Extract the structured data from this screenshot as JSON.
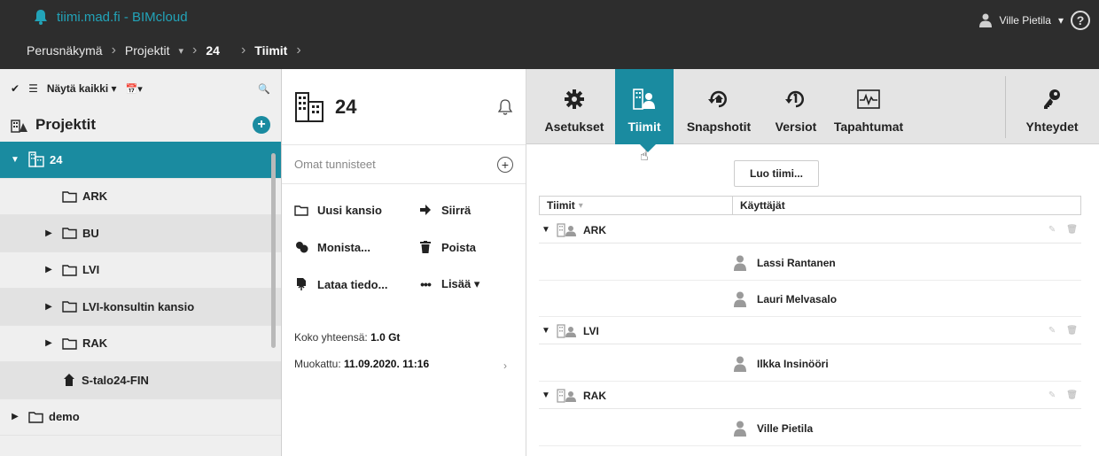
{
  "app": {
    "title": "tiimi.mad.fi - BIMcloud",
    "user": "Ville Pietila",
    "user_caret": "▾",
    "help": "?"
  },
  "breadcrumb": [
    {
      "label": "Perusnäkymä"
    },
    {
      "label": "Projektit",
      "dropdown": "▾"
    },
    {
      "label": "24"
    },
    {
      "label": "Tiimit"
    }
  ],
  "left": {
    "toolbar": {
      "check": "✔",
      "menu": "☰",
      "filter": "Näytä kaikki ▾",
      "calendar": "📅▾",
      "search": "🔍"
    },
    "title": "Projektit",
    "add": "+",
    "items": [
      {
        "label": "24",
        "caret": "▼",
        "kind": "building",
        "selected": true,
        "indent": 0
      },
      {
        "label": "ARK",
        "caret": "",
        "kind": "folder",
        "indent": 1
      },
      {
        "label": "BU",
        "caret": "▶",
        "kind": "folder",
        "indent": 1
      },
      {
        "label": "LVI",
        "caret": "▶",
        "kind": "folder",
        "indent": 1
      },
      {
        "label": "LVI-konsultin kansio",
        "caret": "▶",
        "kind": "folder",
        "indent": 1
      },
      {
        "label": "RAK",
        "caret": "▶",
        "kind": "folder",
        "indent": 1
      },
      {
        "label": "S-talo24-FIN",
        "caret": "",
        "kind": "model",
        "indent": 1
      },
      {
        "label": "demo",
        "caret": "▶",
        "kind": "folder",
        "indent": 0
      }
    ]
  },
  "mid": {
    "number": "24",
    "tags_placeholder": "Omat tunnisteet",
    "tags_add": "+",
    "actions": [
      {
        "label": "Uusi kansio",
        "icon": "folder-icon"
      },
      {
        "label": "Siirrä",
        "icon": "move-arrow-icon"
      },
      {
        "label": "Monista...",
        "icon": "duplicate-icon"
      },
      {
        "label": "Poista",
        "icon": "trash-icon"
      },
      {
        "label": "Lataa tiedo...",
        "icon": "upload-icon"
      },
      {
        "label": "Lisää ▾",
        "icon": "more-dots-icon"
      }
    ],
    "size_label": "Koko yhteensä:",
    "size_value": "1.0 Gt",
    "modified_label": "Muokattu:",
    "modified_value": "11.09.2020. 11:16",
    "modified_arrow": "›",
    "handle_right": "▶",
    "handle_left": "◀"
  },
  "tabs": [
    {
      "label": "Asetukset",
      "icon": "gear-icon"
    },
    {
      "label": "Tiimit",
      "icon": "team-icon",
      "active": true
    },
    {
      "label": "Snapshotit",
      "icon": "snapshot-icon"
    },
    {
      "label": "Versiot",
      "icon": "versions-icon"
    },
    {
      "label": "Tapahtumat",
      "icon": "activity-icon"
    },
    {
      "label": "Yhteydet",
      "icon": "key-icon"
    }
  ],
  "teams": {
    "create_button": "Luo tiimi...",
    "col_team": "Tiimit",
    "col_sort": "▾",
    "col_users": "Käyttäjät",
    "groups": [
      {
        "name": "ARK",
        "users": [
          "Lassi Rantanen",
          "Lauri Melvasalo"
        ]
      },
      {
        "name": "LVI",
        "users": [
          "Ilkka Insinööri"
        ]
      },
      {
        "name": "RAK",
        "users": [
          "Ville Pietila"
        ]
      }
    ],
    "edit_icon": "✎",
    "delete_icon": "🗑"
  },
  "colors": {
    "accent": "#1a8ba0",
    "topbar": "#2d2d2d",
    "brand_text": "#22a3b8"
  }
}
